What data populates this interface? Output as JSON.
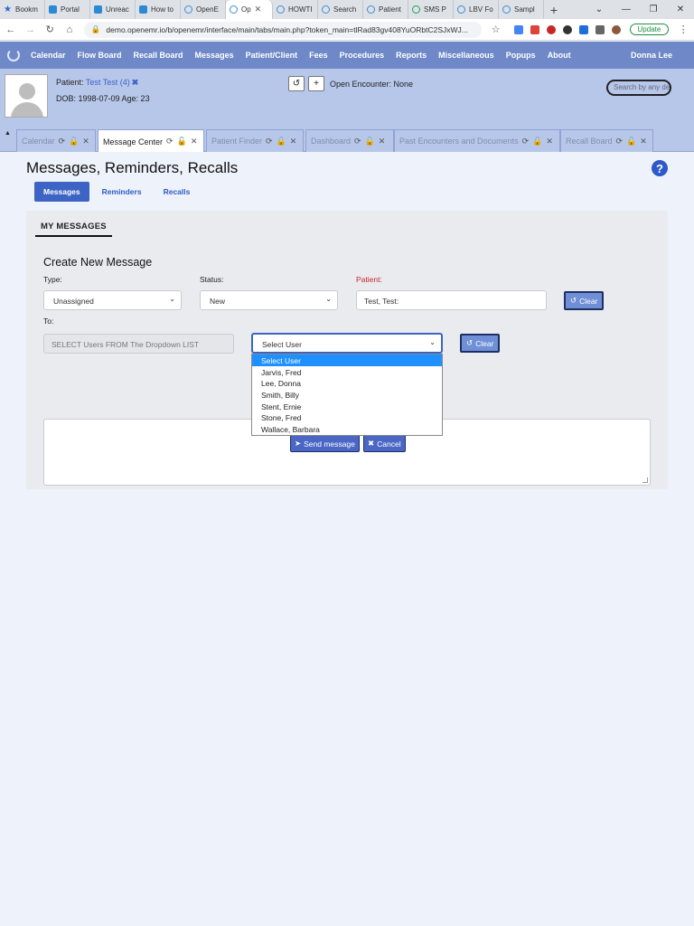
{
  "browser": {
    "tabs": [
      {
        "label": "Bookm",
        "icon": "star-icon"
      },
      {
        "label": "Portal",
        "icon": "page-icon"
      },
      {
        "label": "Unreac",
        "icon": "page-icon"
      },
      {
        "label": "How to",
        "icon": "page-icon"
      },
      {
        "label": "OpenE",
        "icon": "openemr-icon"
      },
      {
        "label": "Op",
        "icon": "openemr-icon",
        "active": true
      },
      {
        "label": "HOWTI",
        "icon": "openemr-icon"
      },
      {
        "label": "Search",
        "icon": "openemr-icon"
      },
      {
        "label": "Patient",
        "icon": "openemr-icon"
      },
      {
        "label": "SMS P",
        "icon": "link-icon"
      },
      {
        "label": "LBV Fo",
        "icon": "openemr-icon"
      },
      {
        "label": "Sampl",
        "icon": "openemr-icon"
      }
    ],
    "url": "demo.openemr.io/b/openemr/interface/main/tabs/main.php?token_main=tlRad83gv408YuORbtC2SJxWJ...",
    "update_label": "Update"
  },
  "nav": {
    "items": [
      "Calendar",
      "Flow Board",
      "Recall Board",
      "Messages",
      "Patient/Client",
      "Fees",
      "Procedures",
      "Reports",
      "Miscellaneous",
      "Popups",
      "About"
    ],
    "user": "Donna Lee"
  },
  "patient": {
    "label": "Patient:",
    "name": "Test Test (4)",
    "dob_line": "DOB: 1998-07-09 Age: 23",
    "encounter": "Open Encounter: None",
    "search_placeholder": "Search by any de"
  },
  "tabs": [
    {
      "label": "Calendar"
    },
    {
      "label": "Message Center",
      "active": true
    },
    {
      "label": "Patient Finder"
    },
    {
      "label": "Dashboard"
    },
    {
      "label": "Past Encounters and Documents"
    },
    {
      "label": "Recall Board"
    }
  ],
  "page": {
    "title": "Messages, Reminders, Recalls",
    "pills": [
      "Messages",
      "Reminders",
      "Recalls"
    ],
    "section": "MY MESSAGES",
    "form_title": "Create New Message",
    "type_label": "Type:",
    "type_value": "Unassigned",
    "status_label": "Status:",
    "status_value": "New",
    "patient_label": "Patient:",
    "patient_value": "Test, Test:",
    "clear_label": "Clear",
    "to_label": "To:",
    "to_placeholder": "SELECT Users FROM The Dropdown LIST",
    "user_select_value": "Select User",
    "user_options": [
      "Select User",
      "Jarvis, Fred",
      "Lee, Donna",
      "Smith, Billy",
      "Stent, Ernie",
      "Stone, Fred",
      "Wallace, Barbara"
    ],
    "send_label": "Send message",
    "cancel_label": "Cancel"
  }
}
